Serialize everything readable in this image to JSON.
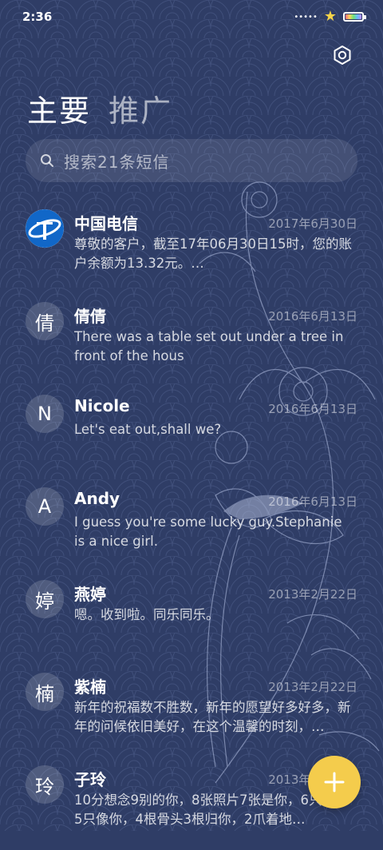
{
  "status_bar": {
    "time": "2:36",
    "signal": "•••••",
    "battery_level": 1.0
  },
  "header": {
    "tabs": [
      {
        "label": "主要",
        "active": true
      },
      {
        "label": "推广",
        "active": false
      }
    ],
    "settings_icon": "gear-icon"
  },
  "search": {
    "placeholder": "搜索21条短信",
    "icon": "search-icon"
  },
  "conversations": [
    {
      "avatar": "",
      "avatar_type": "china-telecom-logo",
      "name": "中国电信",
      "date": "2017年6月30日",
      "preview": "尊敬的客户，截至17年06月30日15时，您的账户余额为13.32元。…"
    },
    {
      "avatar": "倩",
      "name": "倩倩",
      "date": "2016年6月13日",
      "preview": "There was a table set out under a tree in front of the hous"
    },
    {
      "avatar": "N",
      "name": "Nicole",
      "date": "2016年6月13日",
      "preview": "Let's eat out,shall we?"
    },
    {
      "avatar": "A",
      "name": "Andy",
      "date": "2016年6月13日",
      "preview": "I guess you're some lucky guy.Stephanie is a nice girl."
    },
    {
      "avatar": "婷",
      "name": "燕婷",
      "date": "2013年2月22日",
      "preview": "嗯。收到啦。同乐同乐。"
    },
    {
      "avatar": "楠",
      "name": "紫楠",
      "date": "2013年2月22日",
      "preview": "新年的祝福数不胜数，新年的愿望好多好多，新年的问候依旧美好，在这个温馨的时刻，…"
    },
    {
      "avatar": "玲",
      "name": "子玲",
      "date": "2013年2月22日",
      "preview": "10分想念9别的你，8张照片7张是你，6只小狗5只像你，4根骨头3根归你，2爪着地…"
    }
  ],
  "fab": {
    "icon": "plus-icon"
  },
  "colors": {
    "background": "#2f3d66",
    "fab": "#f4cc4c",
    "telecom_blue": "#1167c8"
  }
}
